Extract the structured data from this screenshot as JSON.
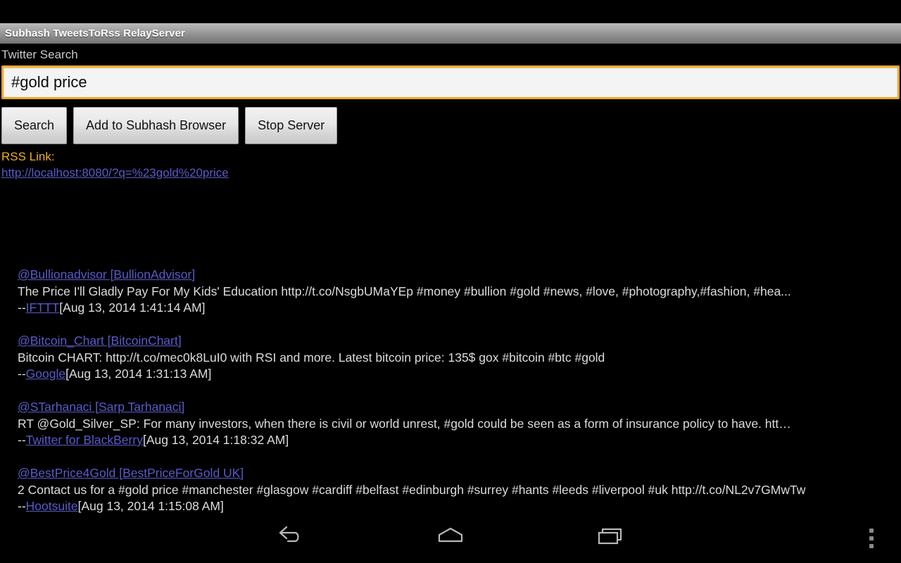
{
  "window": {
    "app_title": "Subhash TweetsToRss RelayServer"
  },
  "search": {
    "label": "Twitter Search",
    "value": "#gold price",
    "placeholder": ""
  },
  "buttons": [
    {
      "label": "Search",
      "name": "search-button"
    },
    {
      "label": "Add to Subhash Browser",
      "name": "add-to-subhash-browser-button"
    },
    {
      "label": "Stop Server",
      "name": "stop-server-button"
    }
  ],
  "rss": {
    "label": "RSS Link:",
    "url": "http://localhost:8080/?q=%23gold%20price"
  },
  "tweets": [
    {
      "handle": "@Bullionadvisor [BullionAdvisor]",
      "text": "The Price I'll Gladly Pay For My Kids' Education http://t.co/NsgbUMaYEp #money #bullion #gold #news, #love, #photography,#fashion, #hea...",
      "dashes": "--",
      "source": "IFTTT",
      "timestamp": "[Aug 13, 2014 1:41:14 AM]"
    },
    {
      "handle": "@Bitcoin_Chart [BitcoinChart]",
      "text": "Bitcoin CHART: http://t.co/mec0k8LuI0 with RSI and more. Latest bitcoin price: 135$ gox #bitcoin #btc #gold",
      "dashes": "--",
      "source": "Google",
      "timestamp": "[Aug 13, 2014 1:31:13 AM]"
    },
    {
      "handle": "@STarhanaci [Sarp Tarhanaci]",
      "text": "RT @Gold_Silver_SP: For many investors, when there is civil or world unrest, #gold could be seen as a form of insurance policy to have. htt…",
      "dashes": "--",
      "source": "Twitter for BlackBerry",
      "timestamp": "[Aug 13, 2014 1:18:32 AM]"
    },
    {
      "handle": "@BestPrice4Gold [BestPriceForGold UK]",
      "text": "2 Contact us for a #gold price #manchester #glasgow #cardiff #belfast #edinburgh #surrey #hants #leeds #liverpool #uk http://t.co/NL2v7GMwTw",
      "dashes": "--",
      "source": "Hootsuite",
      "timestamp": "[Aug 13, 2014 1:15:08 AM]"
    }
  ],
  "navbar": {
    "back": "back-icon",
    "home": "home-icon",
    "recents": "recents-icon",
    "overflow": "overflow-menu-icon"
  },
  "colors": {
    "accent_orange": "#f5a623",
    "rss_label": "#f0ad22",
    "link": "#5a5ac8",
    "body_text": "#dcdcdc",
    "background": "#000000"
  }
}
